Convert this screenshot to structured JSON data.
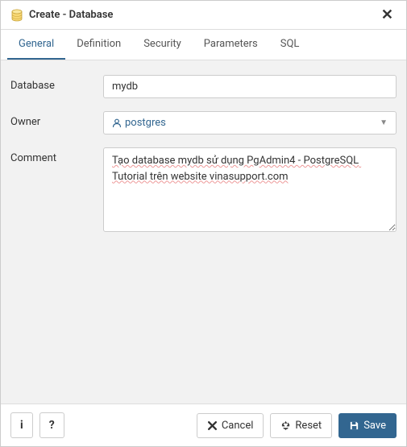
{
  "header": {
    "title": "Create - Database"
  },
  "tabs": {
    "general": "General",
    "definition": "Definition",
    "security": "Security",
    "parameters": "Parameters",
    "sql": "SQL"
  },
  "form": {
    "database_label": "Database",
    "database_value": "mydb",
    "owner_label": "Owner",
    "owner_value": "postgres",
    "comment_label": "Comment",
    "comment_value": "Tạo database mydb sử dụng PgAdmin4 - PostgreSQL Tutorial trên website vinasupport.com"
  },
  "footer": {
    "info": "i",
    "help": "?",
    "cancel": "Cancel",
    "reset": "Reset",
    "save": "Save"
  }
}
